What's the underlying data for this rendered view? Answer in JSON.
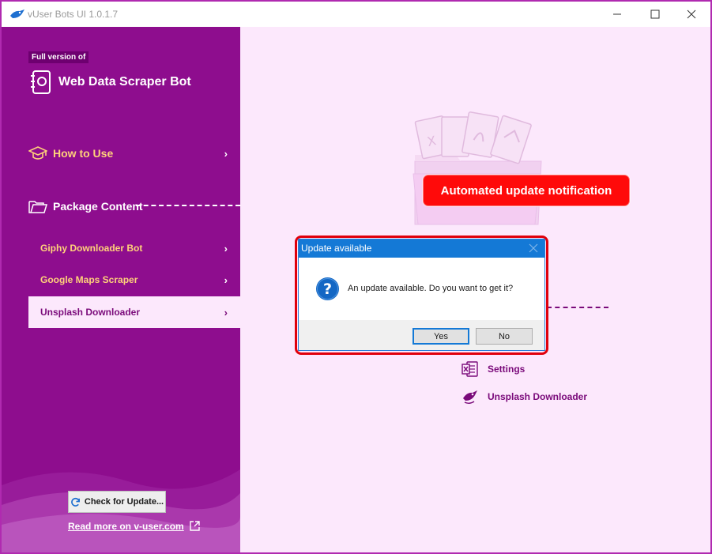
{
  "window": {
    "title": "vUser Bots UI 1.0.1.7"
  },
  "sidebar": {
    "full_version_badge": "Full version of",
    "bot_title": "Web Data Scraper Bot",
    "how_to_use": "How to Use",
    "package_content": "Package Content",
    "items": [
      {
        "label": "Giphy Downloader Bot"
      },
      {
        "label": "Google Maps Scraper"
      },
      {
        "label": "Unsplash Downloader",
        "selected": true
      }
    ],
    "check_update_label": "Check for Update...",
    "read_more_label": "Read more on v-user.com"
  },
  "main": {
    "notification_badge": "Automated update notification",
    "package_entries": [
      {
        "label": "Settings",
        "icon": "excel-icon"
      },
      {
        "label": "Unsplash Downloader",
        "icon": "bot-icon"
      }
    ]
  },
  "dialog": {
    "title": "Update available",
    "message": "An update available. Do you want to get it?",
    "yes_label": "Yes",
    "no_label": "No",
    "icon": "question-icon"
  },
  "colors": {
    "sidebar_bg": "#8e0d8e",
    "main_bg": "#fce8fc",
    "accent_gold": "#ffd27a",
    "badge_red": "#ff0a0a",
    "dialog_title_blue": "#1479d6"
  }
}
